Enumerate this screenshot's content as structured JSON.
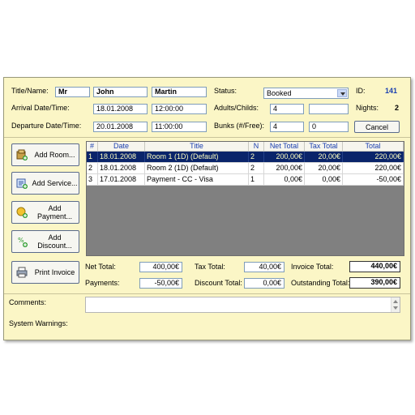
{
  "header": {
    "title_label": "Title/Name:",
    "title_value": "Mr",
    "first_name": "John",
    "last_name": "Martin",
    "status_label": "Status:",
    "status_value": "Booked",
    "id_label": "ID:",
    "id_value": "141",
    "arrival_label": "Arrival Date/Time:",
    "arrival_date": "18.01.2008",
    "arrival_time": "12:00:00",
    "adults_label": "Adults/Childs:",
    "adults_value": "4",
    "childs_value": "",
    "nights_label": "Nights:",
    "nights_value": "2",
    "departure_label": "Departure Date/Time:",
    "departure_date": "20.01.2008",
    "departure_time": "11:00:00",
    "bunks_label": "Bunks (#/Free):",
    "bunks_value": "4",
    "bunks_free": "0",
    "cancel_label": "Cancel"
  },
  "actions": {
    "add_room": "Add Room...",
    "add_service": "Add Service...",
    "add_payment": "Add\nPayment...",
    "add_discount": "Add\nDiscount...",
    "print_invoice": "Print Invoice"
  },
  "grid": {
    "columns": [
      "#",
      "Date",
      "Title",
      "N",
      "Net Total",
      "Tax Total",
      "Total"
    ],
    "rows": [
      [
        "1",
        "18.01.2008",
        "Room 1 (1D)  (Default)",
        "2",
        "200,00€",
        "20,00€",
        "220,00€"
      ],
      [
        "2",
        "18.01.2008",
        "Room 2 (1D)  (Default)",
        "2",
        "200,00€",
        "20,00€",
        "220,00€"
      ],
      [
        "3",
        "17.01.2008",
        "Payment - CC - Visa",
        "1",
        "0,00€",
        "0,00€",
        "-50,00€"
      ]
    ]
  },
  "totals": {
    "net_label": "Net Total:",
    "net_value": "400,00€",
    "tax_label": "Tax Total:",
    "tax_value": "40,00€",
    "invoice_label": "Invoice Total:",
    "invoice_value": "440,00€",
    "payments_label": "Payments:",
    "payments_value": "-50,00€",
    "discount_label": "Discount Total:",
    "discount_value": "0,00€",
    "outstanding_label": "Outstanding Total:",
    "outstanding_value": "390,00€"
  },
  "footer": {
    "comments_label": "Comments:",
    "comments_value": "",
    "warnings_label": "System Warnings:"
  },
  "colors": {
    "window_bg": "#fbf6c6",
    "selected_row": "#0a246a",
    "header_text": "#1a3fb0",
    "id_value": "#1a3fb0"
  }
}
